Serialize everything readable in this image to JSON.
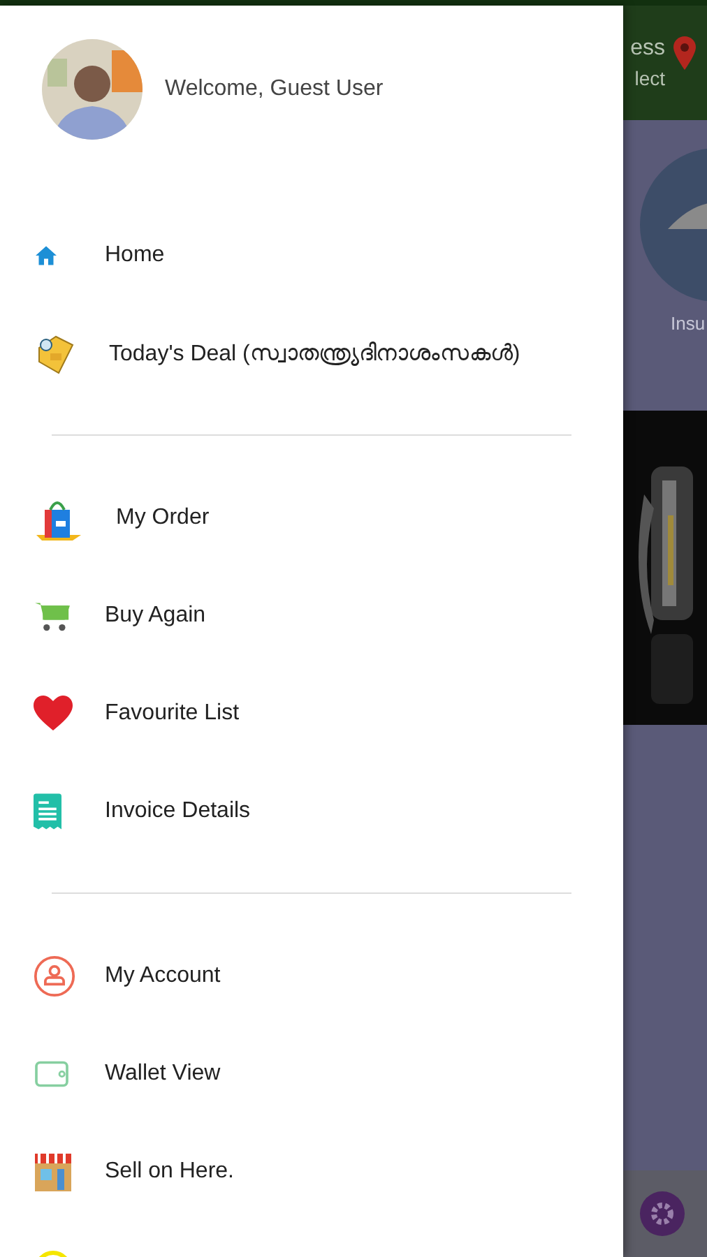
{
  "background": {
    "header_text_1": "ess",
    "header_text_2": "lect",
    "category_label": "Insu"
  },
  "drawer": {
    "greeting": "Welcome,  Guest User",
    "sections": [
      {
        "items": [
          {
            "label": "Home"
          },
          {
            "label": "Today's Deal (സ്വാതന്ത്ര്യദിനാശംസകൾ)"
          }
        ]
      },
      {
        "items": [
          {
            "label": "My Order"
          },
          {
            "label": "Buy Again"
          },
          {
            "label": "Favourite List"
          },
          {
            "label": "Invoice Details"
          }
        ]
      },
      {
        "items": [
          {
            "label": "My Account"
          },
          {
            "label": "Wallet View"
          },
          {
            "label": "Sell on Here."
          }
        ]
      }
    ]
  }
}
